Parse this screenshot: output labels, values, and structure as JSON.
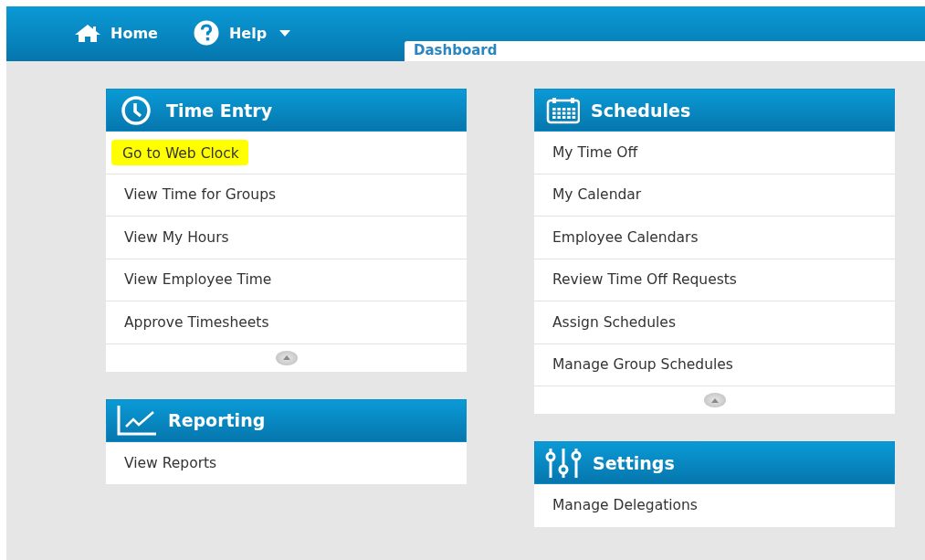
{
  "nav": {
    "items": [
      {
        "label": "Home",
        "kind": "home",
        "dropdown": false
      },
      {
        "label": "Help",
        "kind": "help",
        "dropdown": true
      }
    ]
  },
  "tab": {
    "label": "Dashboard"
  },
  "columns": [
    {
      "panels": [
        {
          "title": "Time Entry",
          "kind": "clock",
          "scroll_button": true,
          "items": [
            {
              "label": "Go to Web Clock",
              "highlighted": true
            },
            {
              "label": "View Time for Groups",
              "highlighted": false
            },
            {
              "label": "View My Hours",
              "highlighted": false
            },
            {
              "label": "View Employee Time",
              "highlighted": false
            },
            {
              "label": "Approve Timesheets",
              "highlighted": false
            }
          ]
        },
        {
          "title": "Reporting",
          "kind": "chart",
          "scroll_button": false,
          "items": [
            {
              "label": "View Reports",
              "highlighted": false
            }
          ]
        }
      ]
    },
    {
      "panels": [
        {
          "title": "Schedules",
          "kind": "calendar",
          "scroll_button": true,
          "items": [
            {
              "label": "My Time Off",
              "highlighted": false
            },
            {
              "label": "My Calendar",
              "highlighted": false
            },
            {
              "label": "Employee Calendars",
              "highlighted": false
            },
            {
              "label": "Review Time Off Requests",
              "highlighted": false
            },
            {
              "label": "Assign Schedules",
              "highlighted": false
            },
            {
              "label": "Manage Group Schedules",
              "highlighted": false
            }
          ]
        },
        {
          "title": "Settings",
          "kind": "sliders",
          "scroll_button": false,
          "items": [
            {
              "label": "Manage Delegations",
              "highlighted": false
            }
          ]
        }
      ]
    }
  ]
}
